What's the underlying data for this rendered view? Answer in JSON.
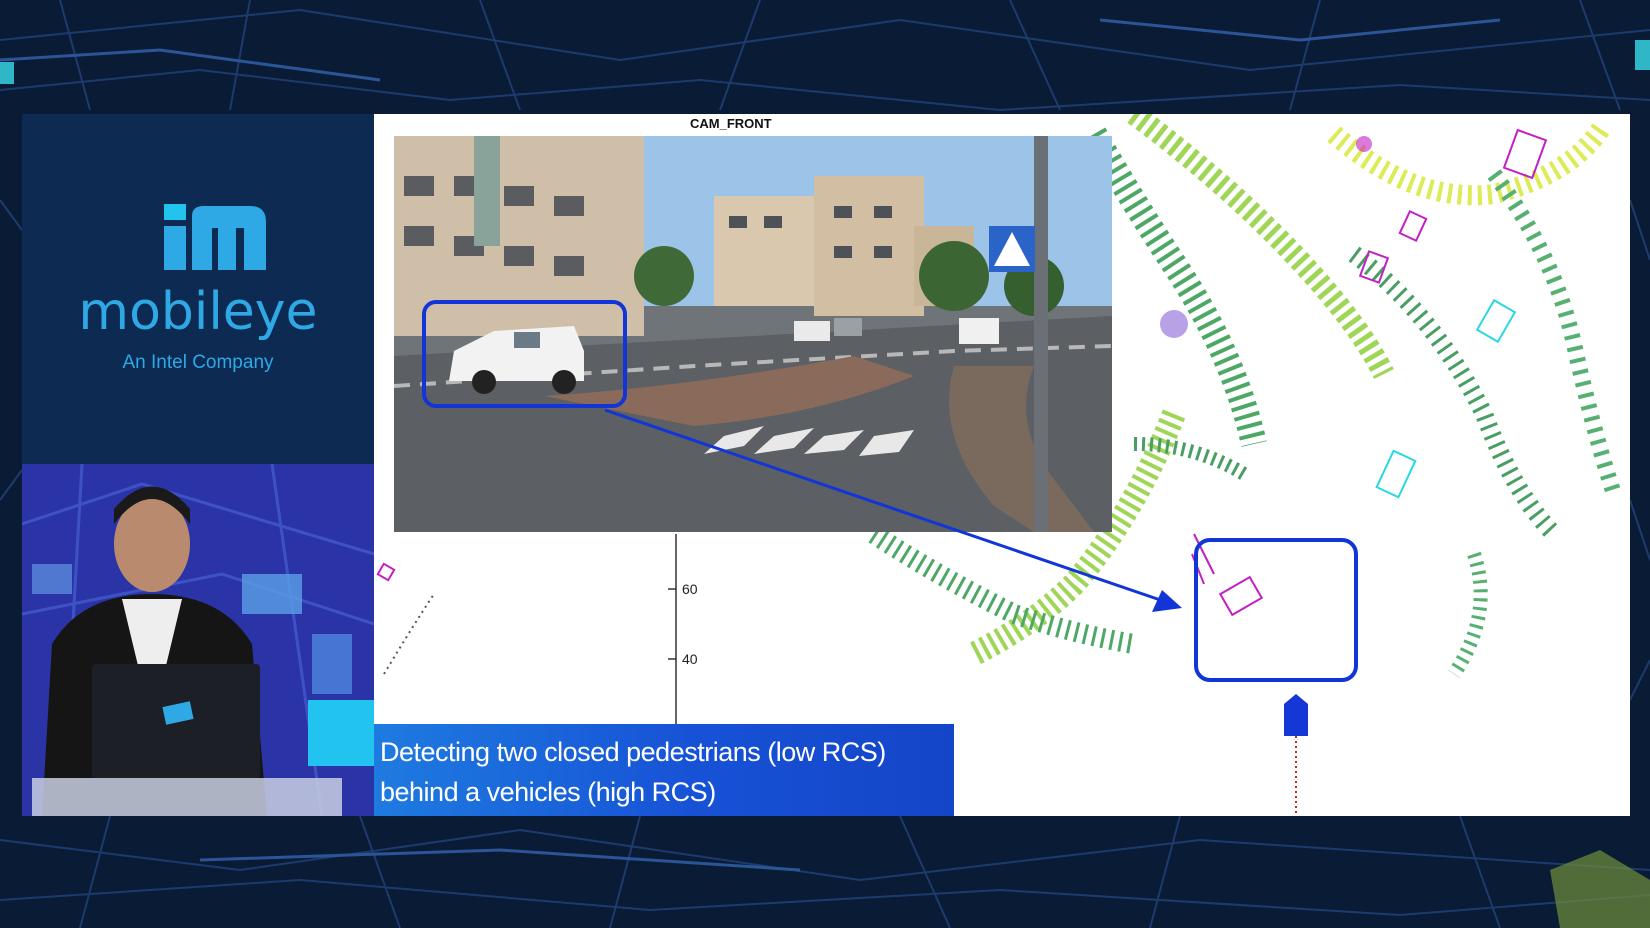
{
  "brand": {
    "wordmark": "mobileye",
    "tagline": "An Intel Company",
    "color": "#2fa8e6"
  },
  "slide": {
    "camera_title": "CAM_FRONT",
    "radar_axis_ticks": [
      "60",
      "40"
    ],
    "caption": "Detecting two closed pedestrians (low RCS) behind a vehicles (high RCS)",
    "highlight_color": "#1235d8",
    "caption_gradient": [
      "#1e7be0",
      "#1445c8"
    ]
  },
  "icons": [
    "mobileye-logo-icon",
    "laptop-logo-icon",
    "ego-vehicle-icon"
  ]
}
